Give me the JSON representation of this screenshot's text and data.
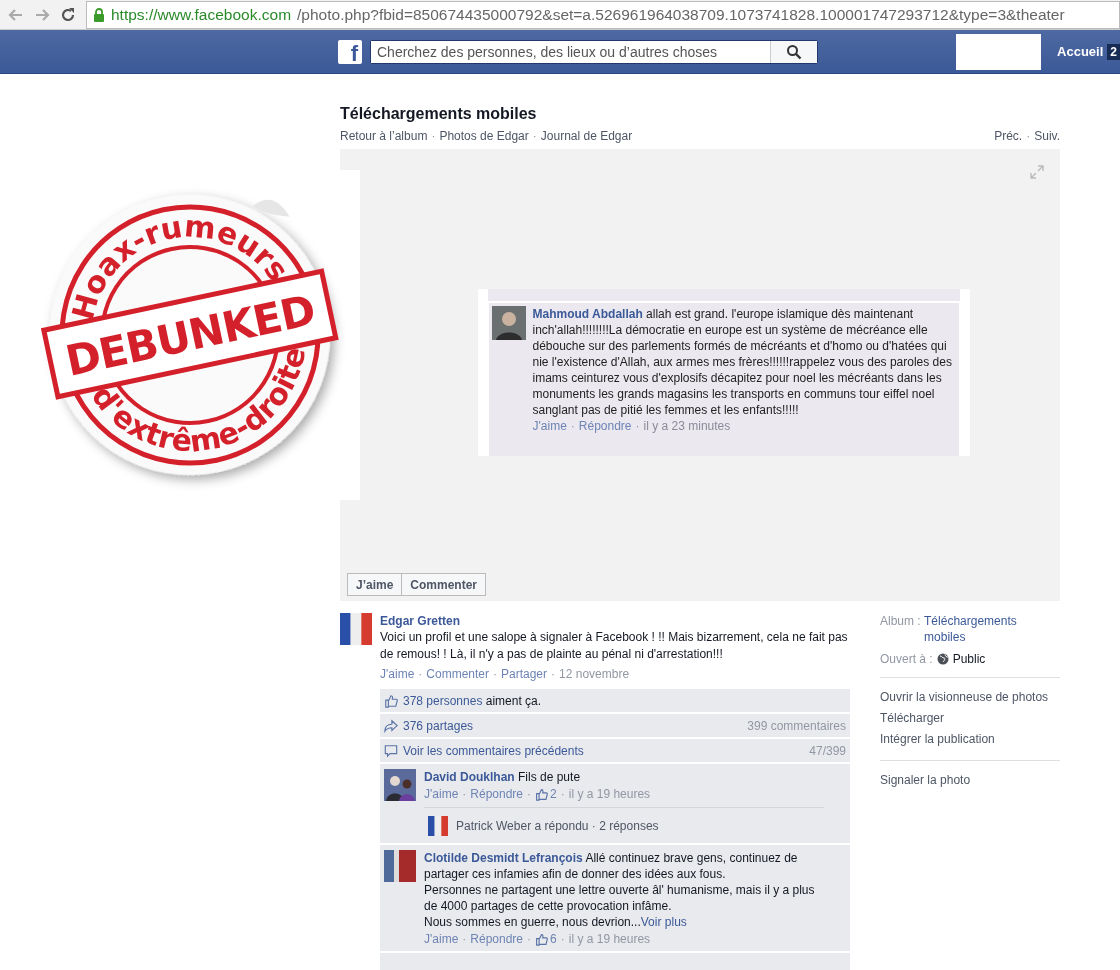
{
  "browser": {
    "url_host": "https://www.facebook.com",
    "url_path": "/photo.php?fbid=850674435000792&set=a.526961964038709.1073741828.100001747293712&type=3&theater"
  },
  "topbar": {
    "logo": "f",
    "search_placeholder": "Cherchez des personnes, des lieux ou d’autres choses",
    "home": "Accueil",
    "home_badge": "2"
  },
  "album": {
    "title": "Téléchargements mobiles",
    "separator": "·",
    "breadcrumbs": [
      "Retour à l’album",
      "Photos de Edgar",
      "Journal de Edgar"
    ],
    "nav": [
      "Préc.",
      "Suiv."
    ]
  },
  "photo": {
    "comment": {
      "author": "Mahmoud Abdallah",
      "separator": "·",
      "text": "allah est grand. l'europe islamique dès maintenant inch'allah!!!!!!!!La démocratie en europe est un système de mécréance elle débouche sur des parlements formés de mécréants et d'homo ou d'hatées qui nie l'existence d'Allah, aux armes mes frères!!!!!!rappelez vous des paroles des imams ceinturez vous d'explosifs décapitez pour noel les mécréants dans les monuments les grands magasins les transports en communs tour eiffel noel sanglant pas de pitié les femmes et les enfants!!!!!",
      "actions": [
        "J'aime",
        "Répondre"
      ],
      "time": "il y a 23 minutes"
    },
    "buttons": [
      "J’aime",
      "Commenter"
    ]
  },
  "post": {
    "author": "Edgar Gretten",
    "separator": "·",
    "text": "Voici un profil et une salope à signaler à Facebook ! !! Mais bizarrement, cela ne fait pas de remous! ! Là, il n'y a pas de plainte au pénal ni d'arrestation!!!",
    "actions": [
      "J'aime",
      "Commenter",
      "Partager"
    ],
    "date": "12 novembre",
    "likes": {
      "link": "378 personnes",
      "text": "aiment ça."
    },
    "shares": "376 partages",
    "comment_count": "399 commentaires",
    "previous": "Voir les commentaires précédents",
    "previous_count": "47/399",
    "comments": [
      {
        "author": "David Douklhan",
        "text": "Fils de pute",
        "separator": "·",
        "actions": [
          "J'aime",
          "Répondre"
        ],
        "likes": "2",
        "time": "il y a 19 heures",
        "reply": "Patrick Weber a répondu · 2 réponses"
      },
      {
        "author": "Clotilde Desmidt Lefrançois",
        "separator": "·",
        "text": "Allé continuez brave gens, continuez de partager ces infamies afin de donner des idées aux fous.\nPersonnes ne partagent une lettre ouverte âl' humanisme, mais il y a plus de 4000 partages de cette provocation infâme.\nNous sommes en guerre, nous devrion...",
        "see_more": "Voir plus",
        "actions": [
          "J'aime",
          "Répondre"
        ],
        "likes": "6",
        "time": "il y a 19 heures"
      }
    ]
  },
  "sidebar": {
    "album_label": "Album :",
    "album_link": "Téléchargements mobiles",
    "audience_label": "Ouvert à :",
    "audience": "Public",
    "links": [
      "Ouvrir la visionneuse de photos",
      "Télécharger",
      "Intégrer la publication"
    ],
    "report": "Signaler la photo"
  },
  "sticker": {
    "top": "Hoax-rumeurs",
    "middle": "DEBUNKED",
    "bottom": "d'extrême-droite"
  }
}
